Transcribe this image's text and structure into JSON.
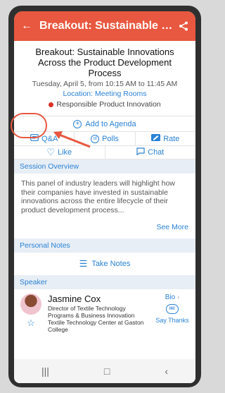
{
  "appbar": {
    "title": "Breakout: Sustainable In…",
    "back_icon": "arrow-back-icon",
    "share_icon": "share-icon"
  },
  "session": {
    "title": "Breakout: Sustainable Innovations Across the Product Development Process",
    "date": "Tuesday, April 5, from 10:15 AM to 11:45 AM",
    "location": "Location: Meeting Rooms",
    "track": "Responsible Product Innovation",
    "track_color": "#d93025"
  },
  "actions": {
    "add_to_agenda": "Add to Agenda",
    "qa": "Q&A",
    "polls": "Polls",
    "rate": "Rate",
    "like": "Like",
    "chat": "Chat"
  },
  "overview": {
    "header": "Session Overview",
    "text": "This panel of industry leaders will highlight how their companies have invested in sustainable innovations across the entire lifecycle of their product development process...",
    "see_more": "See More"
  },
  "notes": {
    "header": "Personal Notes",
    "take_notes": "Take Notes"
  },
  "speaker_section": {
    "header": "Speaker",
    "name": "Jasmine Cox",
    "title": "Director of Textile Technology Programs & Business Innovation Textile Technology Center at Gaston College",
    "bio": "Bio",
    "hi_badge": "Hi!",
    "say_thanks": "Say Thanks"
  },
  "colors": {
    "accent": "#e8573f",
    "link": "#2a82d6",
    "section_bg": "#e8eef5"
  }
}
